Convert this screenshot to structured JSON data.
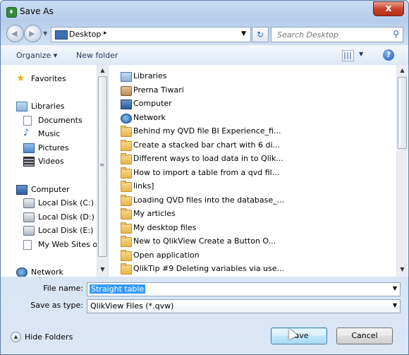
{
  "window": {
    "title": "Save As",
    "close_label": "x"
  },
  "address": {
    "location": "Desktop",
    "separator": "▸"
  },
  "search": {
    "placeholder": "Search Desktop"
  },
  "toolbar": {
    "organize_label": "Organize ▾",
    "new_folder_label": "New folder",
    "help_label": "?"
  },
  "nav": {
    "favorites": "Favorites",
    "libraries": "Libraries",
    "lib_items": [
      "Documents",
      "Music",
      "Pictures",
      "Videos"
    ],
    "computer": "Computer",
    "drives": [
      "Local Disk (C:)",
      "Local Disk (D:)",
      "Local Disk (E:)",
      "My Web Sites on"
    ],
    "network": "Network"
  },
  "files": [
    {
      "name": "Libraries",
      "icon": "library-icon"
    },
    {
      "name": "Prerna Tiwari",
      "icon": "user-folder-icon"
    },
    {
      "name": "Computer",
      "icon": "computer-icon"
    },
    {
      "name": "Network",
      "icon": "network-icon"
    },
    {
      "name": "Behind my QVD file   BI Experience_fi...",
      "icon": "folder-icon"
    },
    {
      "name": "Create a stacked bar chart with 6 di...",
      "icon": "folder-icon"
    },
    {
      "name": "Different ways to load data in to Qlik...",
      "icon": "folder-icon"
    },
    {
      "name": "How to import a table from a qvd fil...",
      "icon": "folder-icon"
    },
    {
      "name": "links]",
      "icon": "folder-icon"
    },
    {
      "name": "Loading QVD files into the database_...",
      "icon": "folder-icon"
    },
    {
      "name": "My articles",
      "icon": "folder-icon"
    },
    {
      "name": "My desktop files",
      "icon": "folder-icon"
    },
    {
      "name": "New to QlikView   Create a Button O...",
      "icon": "folder-icon"
    },
    {
      "name": "Open application",
      "icon": "folder-icon"
    },
    {
      "name": "QlikTip #9   Deleting variables via use...",
      "icon": "folder-icon"
    }
  ],
  "form": {
    "file_name_label": "File name:",
    "file_name_value": "Straight table",
    "save_type_label": "Save as type:",
    "save_type_value": "QlikView Files (*.qvw)"
  },
  "footer": {
    "hide_folders_label": "Hide Folders",
    "save_label": "Save",
    "cancel_label": "Cancel"
  }
}
